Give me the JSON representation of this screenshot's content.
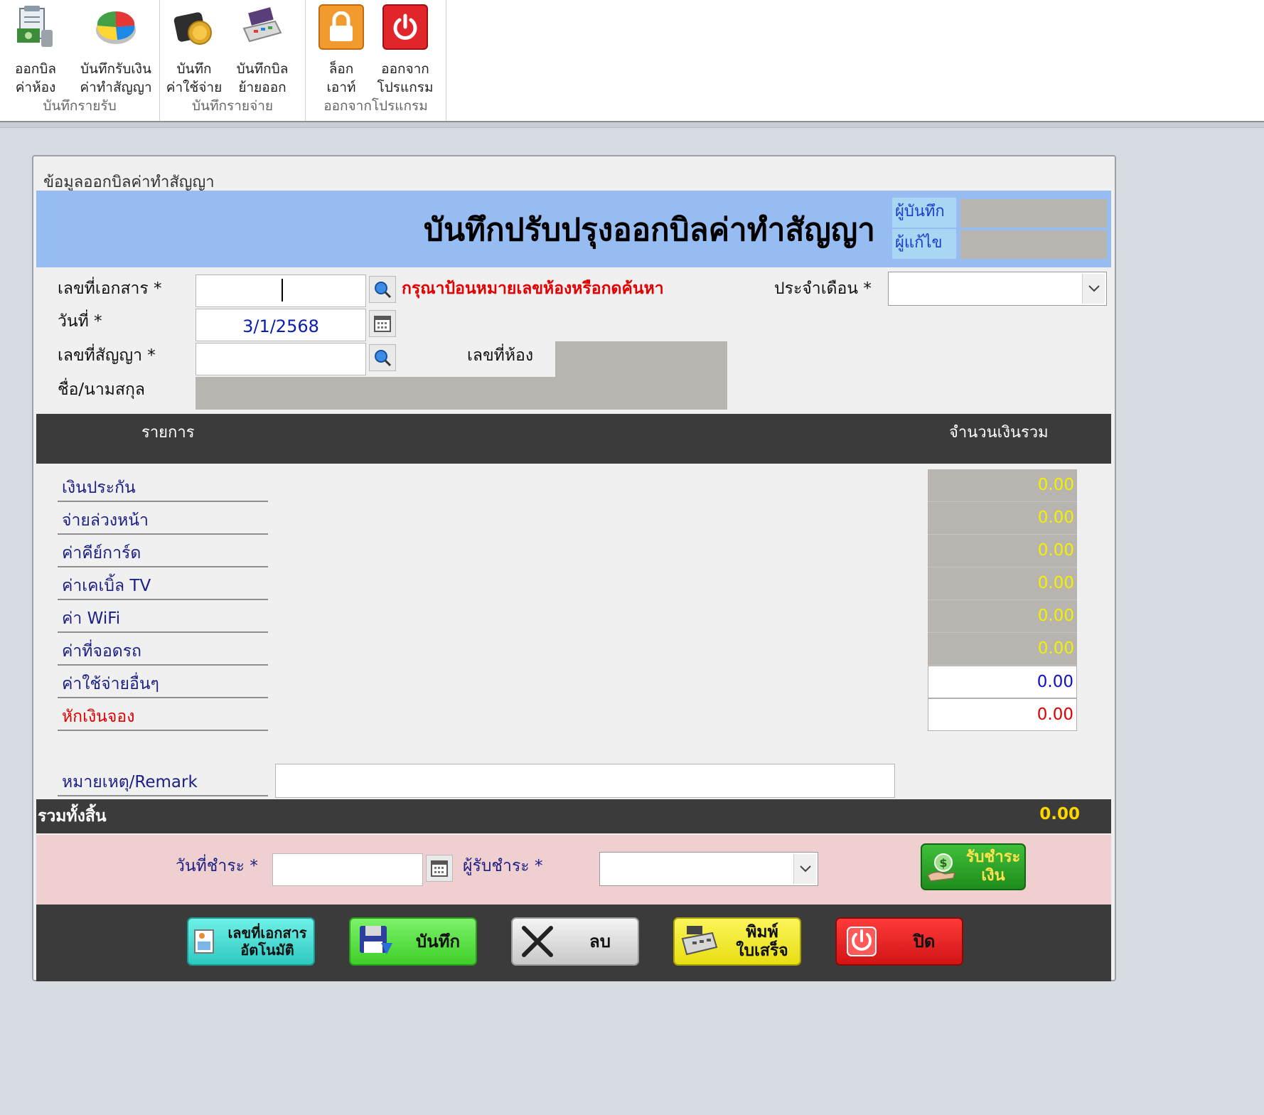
{
  "ribbon": {
    "groups": [
      {
        "name": "บันทึกรายรับ",
        "buttons": [
          {
            "line1": "ออกบิล",
            "line2": "ค่าห้อง"
          },
          {
            "line1": "บันทึกรับเงิน",
            "line2": "ค่าทำสัญญา"
          }
        ]
      },
      {
        "name": "บันทึกรายจ่าย",
        "buttons": [
          {
            "line1": "บันทึก",
            "line2": "ค่าใช้จ่าย"
          },
          {
            "line1": "บันทึกบิล",
            "line2": "ย้ายออก"
          }
        ]
      },
      {
        "name": "ออกจากโปรแกรม",
        "buttons": [
          {
            "line1": "ล็อก",
            "line2": "เอาท์"
          },
          {
            "line1": "ออกจาก",
            "line2": "โปรแกรม"
          }
        ]
      }
    ]
  },
  "window": {
    "title": "ข้อมูลออกบิลค่าทำสัญญา",
    "header_title": "บันทึกปรับปรุงออกบิลค่าทำสัญญา",
    "recorder_label": "ผู้บันทึก",
    "editor_label": "ผู้แก้ไข"
  },
  "form": {
    "doc_no_label": "เลขที่เอกสาร *",
    "doc_no_value": "",
    "hint": "กรุณาป้อนหมายเลขห้องหรือกดค้นหา",
    "month_label": "ประจำเดือน *",
    "date_label": "วันที่ *",
    "date_value": "3/1/2568",
    "contract_label": "เลขที่สัญญา *",
    "room_label": "เลขที่ห้อง",
    "name_label": "ชื่อ/นามสกุล"
  },
  "table": {
    "col_item": "รายการ",
    "col_amount": "จำนวนเงินรวม",
    "items": [
      {
        "label": "เงินประกัน",
        "amount": "0.00"
      },
      {
        "label": "จ่ายล่วงหน้า",
        "amount": "0.00"
      },
      {
        "label": "ค่าคีย์การ์ด",
        "amount": "0.00"
      },
      {
        "label": "ค่าเคเบิ้ล TV",
        "amount": "0.00"
      },
      {
        "label": "ค่า WiFi",
        "amount": "0.00"
      },
      {
        "label": "ค่าที่จอดรถ",
        "amount": "0.00"
      },
      {
        "label": "ค่าใช้จ่ายอื่นๆ",
        "amount": "0.00"
      },
      {
        "label": "หักเงินจอง",
        "amount": "0.00"
      }
    ],
    "remark_label": "หมายเหตุ/Remark",
    "total_label": "รวมทั้งสิ้น",
    "total_value": "0.00"
  },
  "payment": {
    "pay_date_label": "วันที่ชำระ *",
    "receiver_label": "ผู้รับชำระ *",
    "receive_button_line1": "รับชำระ",
    "receive_button_line2": "เงิน"
  },
  "footer": {
    "auto_doc_line1": "เลขที่เอกสาร",
    "auto_doc_line2": "อัตโนมัติ",
    "save": "บันทึก",
    "delete": "ลบ",
    "print_line1": "พิมพ์",
    "print_line2": "ใบเสร็จ",
    "close": "ปิด"
  },
  "colors": {
    "header_blue": "#96bcf2",
    "dark_band": "#3b3b3b",
    "readonly_gray": "#b8b4b0",
    "hint_red": "#e30000",
    "amount_yellow": "#f2f200",
    "pay_pink": "#efcfd0"
  }
}
